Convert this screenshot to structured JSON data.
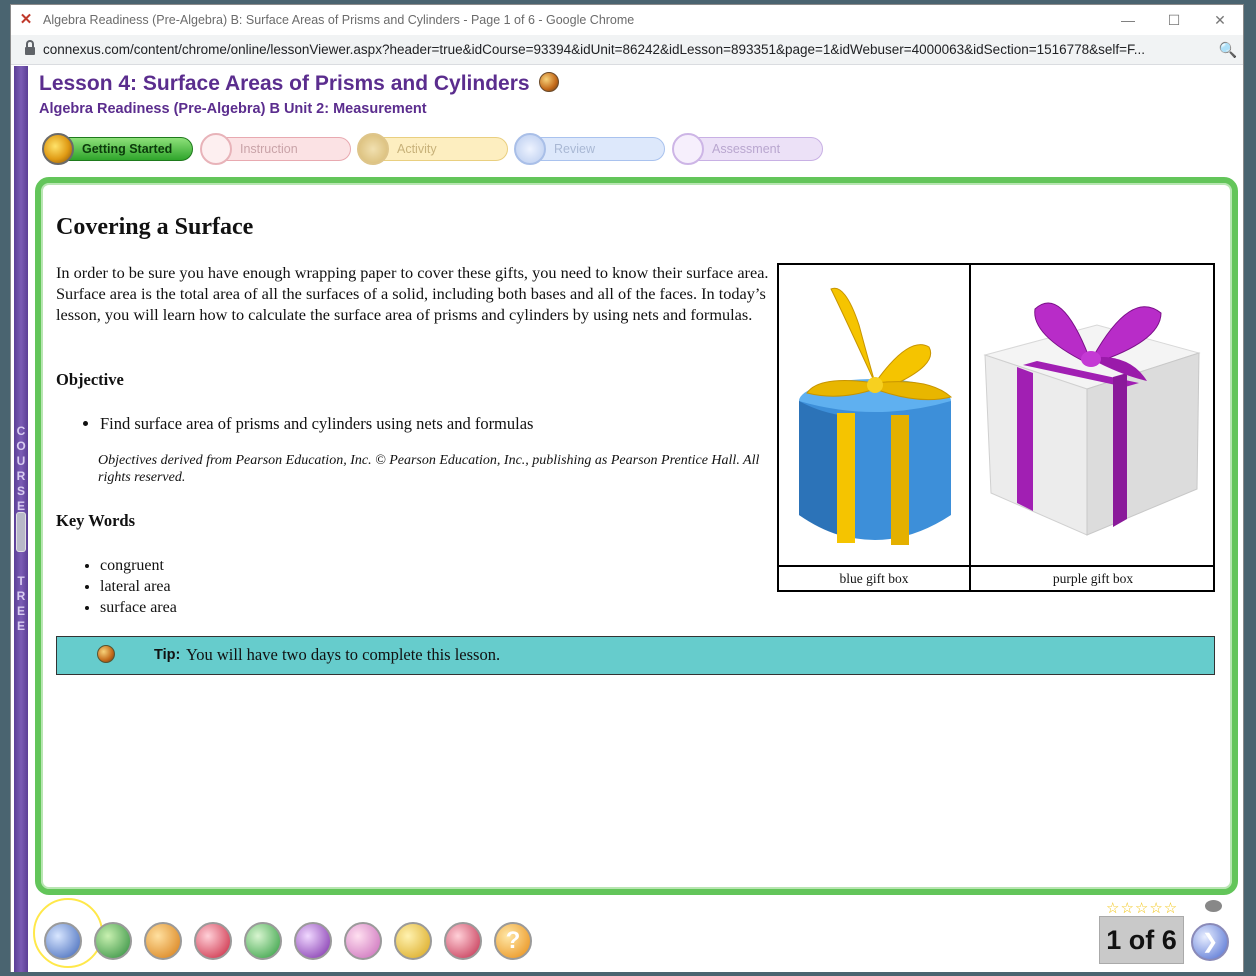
{
  "browser": {
    "window_title": "Algebra Readiness (Pre-Algebra) B: Surface Areas of Prisms and Cylinders - Page 1 of 6 - Google Chrome",
    "url": "connexus.com/content/chrome/online/lessonViewer.aspx?header=true&idCourse=93394&idUnit=86242&idLesson=893351&page=1&idWebuser=4000063&idSection=1516778&self=F...",
    "minimize_glyph": "—",
    "maximize_glyph": "☐",
    "close_glyph": "✕",
    "app_glyph": "✕",
    "zoom_glyph": "🔍"
  },
  "sidebar": {
    "course_tree_letters": [
      "C",
      "O",
      "U",
      "R",
      "S",
      "E",
      "",
      "",
      "",
      "",
      "T",
      "R",
      "E",
      "E"
    ]
  },
  "lesson": {
    "title": "Lesson 4: Surface Areas of Prisms and Cylinders",
    "subtitle": "Algebra Readiness (Pre-Algebra) B  Unit 2: Measurement"
  },
  "tabs": [
    {
      "label": "Getting Started",
      "active": true
    },
    {
      "label": "Instruction",
      "active": false
    },
    {
      "label": "Activity",
      "active": false
    },
    {
      "label": "Review",
      "active": false
    },
    {
      "label": "Assessment",
      "active": false
    }
  ],
  "main": {
    "heading": "Covering a Surface",
    "intro": "In order to be sure you have enough wrapping paper to cover these gifts, you need to know their surface area. Surface area is the total area of all the surfaces of a solid, including both bases and all of the faces. In today’s lesson, you will learn how to calculate the surface area of prisms and cylinders by using nets and formulas.",
    "objective_heading": "Objective",
    "objectives": [
      "Find surface area of prisms and cylinders using nets and formulas"
    ],
    "objective_note": "Objectives derived from Pearson Education, Inc. © Pearson Education, Inc., publishing as Pearson Prentice Hall. All rights reserved.",
    "keywords_heading": "Key Words",
    "keywords": [
      "congruent",
      "lateral area",
      "surface area"
    ],
    "images": [
      {
        "caption": "blue gift box"
      },
      {
        "caption": "purple gift box"
      }
    ],
    "tip_label": "Tip:",
    "tip_text": "You will have two days to complete this lesson."
  },
  "footer": {
    "rating_stars": "☆☆☆☆☆",
    "page_counter": "1 of 6",
    "next_glyph": "❯",
    "help_glyph": "?",
    "toolbar_icons": [
      "search-icon",
      "book-icon",
      "box-icon",
      "pushpin-icon",
      "grid-icon",
      "target-icon",
      "screen-icon",
      "print-icon",
      "tools-icon",
      "help-icon"
    ]
  },
  "colors": {
    "title_purple": "#5b2d8e",
    "frame_green": "#63c55a",
    "tip_teal": "#66cccc",
    "blue_gift": "#3d8fd9",
    "gold_ribbon": "#f5c400",
    "purple_ribbon": "#a11fb3"
  }
}
